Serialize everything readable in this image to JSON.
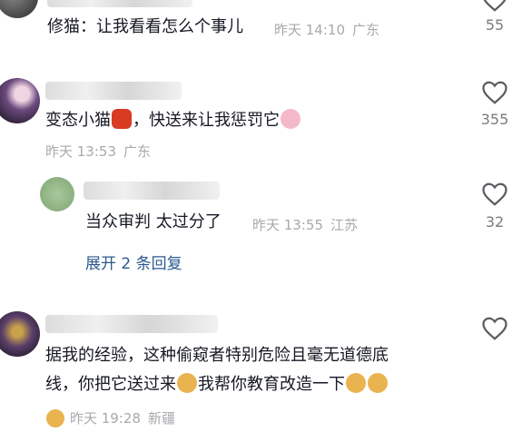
{
  "top_comment": {
    "text": "修猫：让我看看怎么个事儿",
    "time": "昨天 14:10",
    "location": "广东",
    "likes": "55"
  },
  "comment1": {
    "text_before": "变态小猫",
    "text_after": "，快送来让我惩罚它",
    "time": "昨天 13:53",
    "location": "广东",
    "likes": "355"
  },
  "reply1": {
    "text": "当众审判 太过分了",
    "time": "昨天 13:55",
    "location": "江苏",
    "likes": "32"
  },
  "expand_replies": "展开 2 条回复",
  "comment2": {
    "line1": "据我的经验，这种偷窥者特别危险且毫无道德底",
    "line2_a": "线，你把它送过来",
    "line2_b": "我帮你教育改造一下",
    "time": "昨天 19:28",
    "location": "新疆"
  },
  "icons": {
    "like": "heart-outline-icon",
    "emoji_devil": "angry-devil-emoji",
    "emoji_love": "heart-eyes-emoji",
    "emoji_doge": "doge-emoji"
  }
}
